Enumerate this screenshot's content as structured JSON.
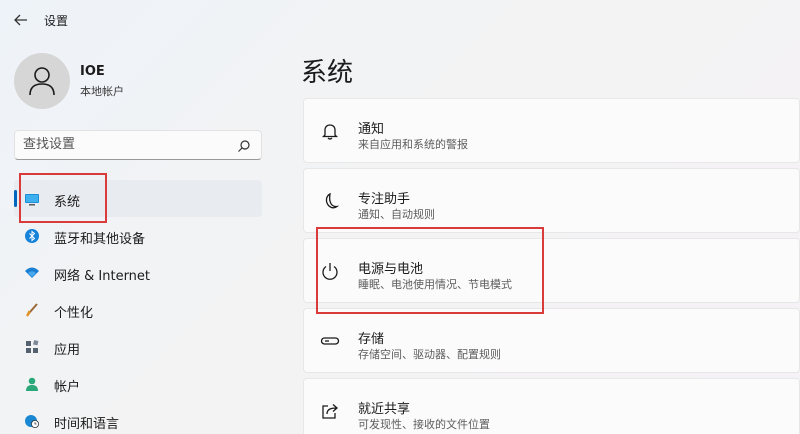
{
  "app": {
    "title": "设置"
  },
  "user": {
    "name": "IOE",
    "account_type": "本地帐户"
  },
  "search": {
    "placeholder": "查找设置"
  },
  "sidebar": {
    "items": [
      {
        "label": "系统",
        "icon": "system-display-icon",
        "active": true
      },
      {
        "label": "蓝牙和其他设备",
        "icon": "bluetooth-icon"
      },
      {
        "label": "网络 & Internet",
        "icon": "wifi-icon"
      },
      {
        "label": "个性化",
        "icon": "brush-icon"
      },
      {
        "label": "应用",
        "icon": "apps-icon"
      },
      {
        "label": "帐户",
        "icon": "account-icon"
      },
      {
        "label": "时间和语言",
        "icon": "globe-clock-icon"
      }
    ]
  },
  "main": {
    "title": "系统",
    "cards": [
      {
        "title": "通知",
        "desc": "来自应用和系统的警报",
        "icon": "bell-icon"
      },
      {
        "title": "专注助手",
        "desc": "通知、自动规则",
        "icon": "moon-icon"
      },
      {
        "title": "电源与电池",
        "desc": "睡眠、电池使用情况、节电模式",
        "icon": "power-icon"
      },
      {
        "title": "存储",
        "desc": "存储空间、驱动器、配置规则",
        "icon": "storage-icon"
      },
      {
        "title": "就近共享",
        "desc": "可发现性、接收的文件位置",
        "icon": "share-icon"
      }
    ]
  },
  "colors": {
    "accent": "#0067c0",
    "highlight": "#d93a3a"
  }
}
